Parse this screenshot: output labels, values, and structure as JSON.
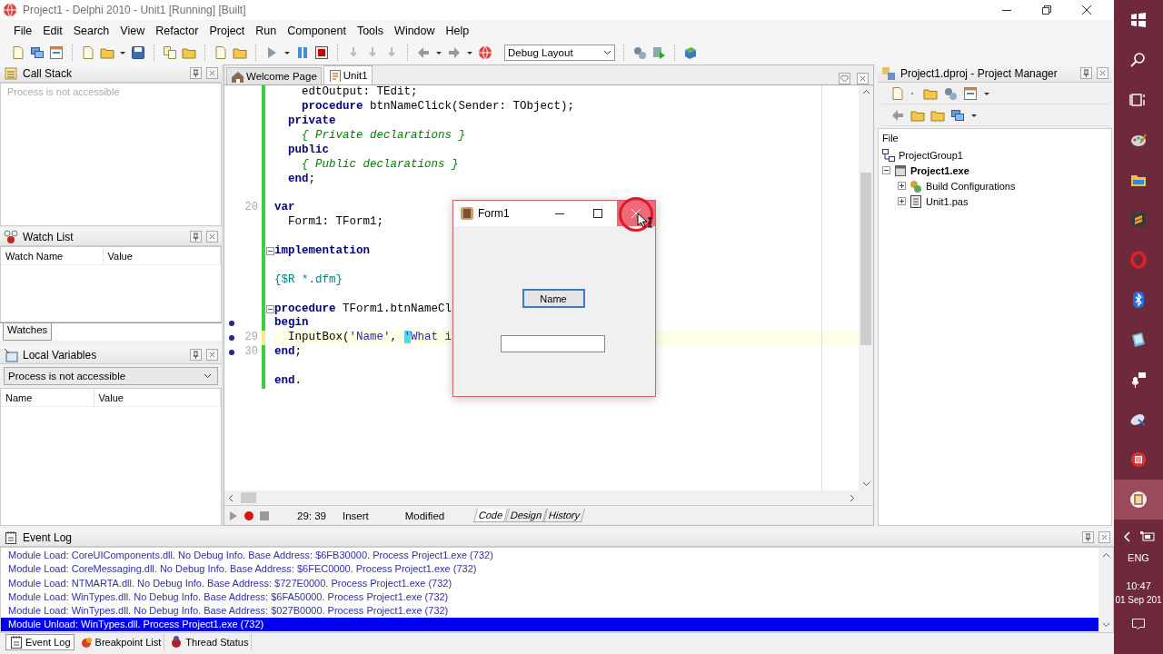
{
  "window": {
    "title": "Project1 - Delphi 2010 - Unit1 [Running] [Built]"
  },
  "menu": [
    "File",
    "Edit",
    "Search",
    "View",
    "Refactor",
    "Project",
    "Run",
    "Component",
    "Tools",
    "Window",
    "Help"
  ],
  "toolbar": {
    "layout": "Debug Layout"
  },
  "call_stack": {
    "title": "Call Stack",
    "message": "Process is not accessible"
  },
  "watch_list": {
    "title": "Watch List",
    "columns": [
      "Watch Name",
      "Value"
    ],
    "tabs": [
      {
        "label": "Watches",
        "selected": true
      }
    ]
  },
  "local_variables": {
    "title": "Local Variables",
    "selector": "Process is not accessible",
    "columns": [
      "Name",
      "Value"
    ]
  },
  "editor": {
    "tabs": [
      {
        "label": "Welcome Page",
        "selected": false
      },
      {
        "label": "Unit1",
        "selected": true
      }
    ],
    "lines": [
      {
        "breakpoint": false,
        "foldable": false,
        "current": false,
        "tokens": [
          {
            "kind": "text",
            "text": "    edtOutput: TEdit;"
          }
        ]
      },
      {
        "breakpoint": false,
        "foldable": false,
        "current": false,
        "tokens": [
          {
            "kind": "keyword",
            "text": "    procedure"
          },
          {
            "kind": "text",
            "text": " btnNameClick(Sender: TObject);"
          }
        ]
      },
      {
        "breakpoint": false,
        "foldable": false,
        "current": false,
        "tokens": [
          {
            "kind": "keyword",
            "text": "  private"
          }
        ]
      },
      {
        "breakpoint": false,
        "foldable": false,
        "current": false,
        "tokens": [
          {
            "kind": "comment",
            "text": "    { Private declarations }"
          }
        ]
      },
      {
        "breakpoint": false,
        "foldable": false,
        "current": false,
        "tokens": [
          {
            "kind": "keyword",
            "text": "  public"
          }
        ]
      },
      {
        "breakpoint": false,
        "foldable": false,
        "current": false,
        "tokens": [
          {
            "kind": "comment",
            "text": "    { Public declarations }"
          }
        ]
      },
      {
        "breakpoint": false,
        "foldable": false,
        "current": false,
        "tokens": [
          {
            "kind": "keyword",
            "text": "  end"
          },
          {
            "kind": "text",
            "text": ";"
          }
        ]
      },
      {
        "breakpoint": false,
        "foldable": false,
        "current": false
      },
      {
        "breakpoint": false,
        "foldable": false,
        "current": false,
        "number": "20",
        "tokens": [
          {
            "kind": "keyword",
            "text": "var"
          }
        ]
      },
      {
        "breakpoint": false,
        "foldable": false,
        "current": false,
        "tokens": [
          {
            "kind": "text",
            "text": "  Form1: TForm1;"
          }
        ]
      },
      {
        "breakpoint": false,
        "foldable": false,
        "current": false
      },
      {
        "breakpoint": false,
        "foldable": true,
        "current": false,
        "tokens": [
          {
            "kind": "keyword",
            "text": "implementation"
          }
        ]
      },
      {
        "breakpoint": false,
        "foldable": false,
        "current": false
      },
      {
        "breakpoint": false,
        "foldable": false,
        "current": false,
        "tokens": [
          {
            "kind": "directive",
            "text": "{$R *.dfm}"
          }
        ]
      },
      {
        "breakpoint": false,
        "foldable": false,
        "current": false
      },
      {
        "breakpoint": false,
        "foldable": true,
        "current": false,
        "tokens": [
          {
            "kind": "keyword",
            "text": "procedure"
          },
          {
            "kind": "text",
            "text": " TForm1.btnNameCl"
          }
        ]
      },
      {
        "breakpoint": true,
        "foldable": false,
        "current": false,
        "tokens": [
          {
            "kind": "keyword",
            "text": "begin"
          }
        ]
      },
      {
        "breakpoint": true,
        "foldable": false,
        "current": true,
        "number": "29",
        "tokens": [
          {
            "kind": "text",
            "text": "  InputBox("
          },
          {
            "kind": "string",
            "text": "'Name'"
          },
          {
            "kind": "text",
            "text": ", "
          },
          {
            "kind": "match",
            "text": "'"
          },
          {
            "kind": "string",
            "text": "What i"
          }
        ]
      },
      {
        "breakpoint": true,
        "foldable": false,
        "current": false,
        "number": "30",
        "tokens": [
          {
            "kind": "keyword",
            "text": "end"
          },
          {
            "kind": "text",
            "text": ";"
          }
        ]
      },
      {
        "breakpoint": false,
        "foldable": false,
        "current": false
      },
      {
        "breakpoint": false,
        "foldable": false,
        "current": false,
        "tokens": [
          {
            "kind": "keyword",
            "text": "end"
          },
          {
            "kind": "text",
            "text": "."
          }
        ]
      }
    ],
    "status": {
      "position": "29: 39",
      "mode": "Insert",
      "state": "Modified"
    },
    "view_tabs": [
      {
        "label": "Code",
        "selected": true
      },
      {
        "label": "Design",
        "selected": false
      },
      {
        "label": "History",
        "selected": false
      }
    ]
  },
  "form_window": {
    "title": "Form1",
    "button": "Name",
    "close_hovered": true
  },
  "project_manager": {
    "title": "Project1.dproj - Project Manager",
    "column": "File",
    "tree": [
      {
        "label": "ProjectGroup1",
        "active": false,
        "children": [
          {
            "label": "Project1.exe",
            "active": true,
            "expanded": true,
            "children": [
              {
                "label": "Build Configurations",
                "active": false,
                "expanded": false
              },
              {
                "label": "Unit1.pas",
                "active": false,
                "expanded": false
              }
            ]
          }
        ]
      }
    ]
  },
  "event_log": {
    "title": "Event Log",
    "entries": [
      {
        "text": "Module Load: CoreUIComponents.dll. No Debug Info. Base Address: $6FB30000. Process Project1.exe (732)",
        "selected": false
      },
      {
        "text": "Module Load: CoreMessaging.dll. No Debug Info. Base Address: $6FEC0000. Process Project1.exe (732)",
        "selected": false
      },
      {
        "text": "Module Load: NTMARTA.dll. No Debug Info. Base Address: $727E0000. Process Project1.exe (732)",
        "selected": false
      },
      {
        "text": "Module Load: WinTypes.dll. No Debug Info. Base Address: $6FA50000. Process Project1.exe (732)",
        "selected": false
      },
      {
        "text": "Module Load: WinTypes.dll. No Debug Info. Base Address: $027B0000. Process Project1.exe (732)",
        "selected": false
      },
      {
        "text": "Module Unload: WinTypes.dll. Process Project1.exe (732)",
        "selected": true
      }
    ],
    "tabs": [
      {
        "label": "Event Log",
        "selected": true
      },
      {
        "label": "Breakpoint List",
        "selected": false
      },
      {
        "label": "Thread Status",
        "selected": false
      }
    ]
  },
  "taskbar": {
    "apps": [
      {
        "selected": false
      },
      {
        "selected": false
      },
      {
        "selected": false
      },
      {
        "selected": false
      },
      {
        "selected": false
      },
      {
        "selected": false
      },
      {
        "selected": false
      },
      {
        "selected": false
      },
      {
        "selected": false
      },
      {
        "selected": true
      }
    ],
    "language": "ENG",
    "time": "10:47",
    "date": "01 Sep 201"
  }
}
